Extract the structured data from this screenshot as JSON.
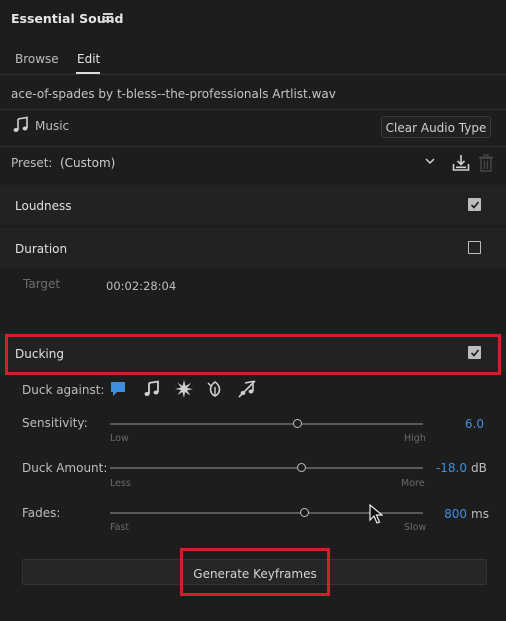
{
  "panel": {
    "title": "Essential Sound"
  },
  "tabs": [
    {
      "label": "Browse",
      "active": false
    },
    {
      "label": "Edit",
      "active": true
    }
  ],
  "clip": {
    "filename": "ace-of-spades by t-bless--the-professionals Artlist.wav"
  },
  "audio_type": {
    "label": "Music",
    "icon": "music-note-icon",
    "clear_label": "Clear Audio Type"
  },
  "preset": {
    "label": "Preset:",
    "value": "(Custom)"
  },
  "sections": {
    "loudness": {
      "label": "Loudness",
      "checked": true
    },
    "duration": {
      "label": "Duration",
      "checked": false,
      "target_label": "Target",
      "target_value": "00:02:28:04"
    },
    "ducking": {
      "label": "Ducking",
      "checked": true
    }
  },
  "duck_against": {
    "label": "Duck against:",
    "icons": [
      "dialogue-icon",
      "music-icon",
      "sfx-icon",
      "ambience-icon",
      "unassigned-icon"
    ],
    "selected": "dialogue-icon"
  },
  "sliders": [
    {
      "label": "Sensitivity:",
      "min": "Low",
      "max": "High",
      "value": "6.0",
      "unit": "",
      "position": 0.6
    },
    {
      "label": "Duck Amount:",
      "min": "Less",
      "max": "More",
      "value": "-18.0",
      "unit": "dB",
      "position": 0.62
    },
    {
      "label": "Fades:",
      "min": "Fast",
      "max": "Slow",
      "value": "800",
      "unit": "ms",
      "position": 0.62
    }
  ],
  "generate": {
    "label": "Generate Keyframes"
  },
  "colors": {
    "highlight": "#d0202a",
    "value_blue": "#3f8fe0",
    "panel_bg": "#1d1d1d"
  }
}
